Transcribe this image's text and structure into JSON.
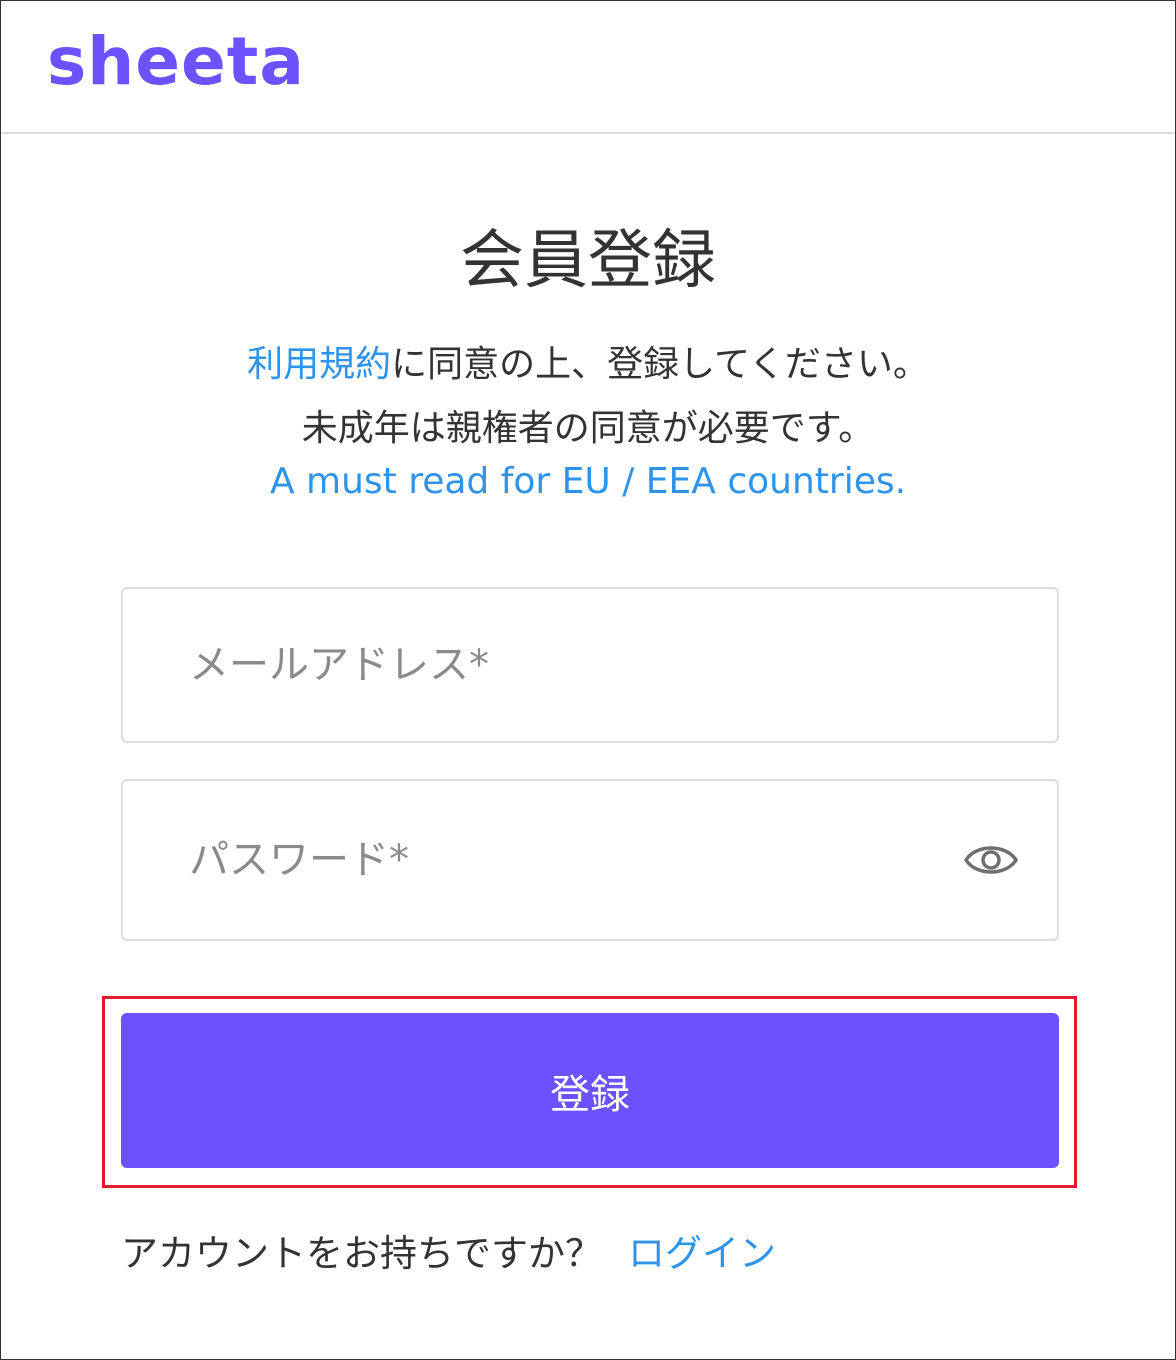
{
  "header": {
    "logo_text": "sheeta",
    "brand_color": "#6c51ff"
  },
  "main": {
    "title": "会員登録",
    "terms_link": "利用規約",
    "terms_text": "に同意の上、登録してください。",
    "minor_notice": "未成年は親権者の同意が必要です。",
    "eu_link": "A must read for EU / EEA countries.",
    "link_color": "#2e94eb"
  },
  "form": {
    "email_placeholder": "メールアドレス*",
    "email_value": "",
    "password_placeholder": "パスワード*",
    "password_value": "",
    "password_toggle_icon": "eye-icon",
    "submit_label": "登録",
    "highlight_color": "#e01c2a"
  },
  "footer": {
    "question": "アカウントをお持ちですか？",
    "login_link": "ログイン"
  }
}
